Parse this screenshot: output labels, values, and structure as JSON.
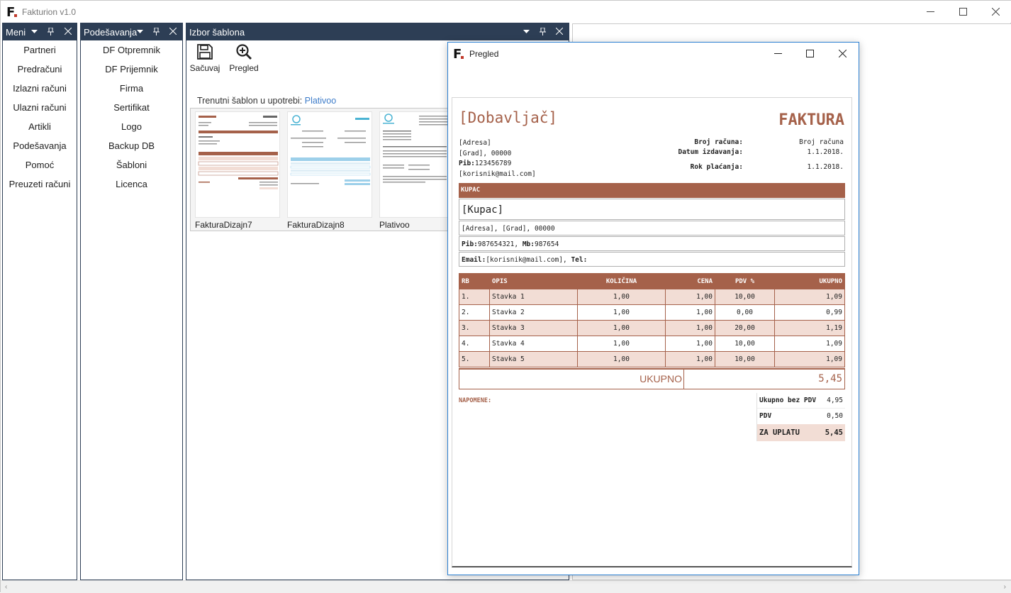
{
  "app": {
    "title": "Fakturion v1.0",
    "logo_letter": "F."
  },
  "menu_panel": {
    "title": "Meni",
    "items": [
      "Partneri",
      "Predračuni",
      "Izlazni računi",
      "Ulazni računi",
      "Artikli",
      "Podešavanja",
      "Pomoć",
      "Preuzeti računi"
    ]
  },
  "settings_panel": {
    "title": "Podešavanja",
    "items": [
      "DF Otpremnik",
      "DF Prijemnik",
      "Firma",
      "Sertifikat",
      "Logo",
      "Backup DB",
      "Šabloni",
      "Licenca"
    ]
  },
  "template_panel": {
    "title": "Izbor šablona",
    "save_label": "Sačuvaj",
    "preview_label": "Pregled",
    "current_label": "Trenutni šablon u upotrebi:",
    "current_value": "Plativoo",
    "templates": [
      "FakturaDizajn7",
      "FakturaDizajn8",
      "Plativoo"
    ]
  },
  "preview_window": {
    "title": "Pregled",
    "invoice": {
      "supplier": "[Dobavljač]",
      "doc_title": "FAKTURA",
      "address": "[Adresa]",
      "city": "[Grad], 00000",
      "pib_label": "Pib:",
      "pib": "123456789",
      "email": "[korisnik@mail.com]",
      "invoice_no_label": "Broj računa:",
      "invoice_no": "Broj računa",
      "issue_date_label": "Datum izdavanja:",
      "issue_date": "1.1.2018.",
      "due_label": "Rok plaćanja:",
      "due_date": "1.1.2018.",
      "buyer_section": "KUPAC",
      "buyer_name": "[Kupac]",
      "buyer_address": "[Adresa], [Grad], 00000",
      "buyer_pib_label": "Pib:",
      "buyer_pib": "987654321, ",
      "buyer_mb_label": "Mb:",
      "buyer_mb": "987654",
      "buyer_email_label": "Email:",
      "buyer_email": "[korisnik@mail.com], ",
      "buyer_tel_label": "Tel:",
      "columns": [
        "RB",
        "OPIS",
        "KOLIČINA",
        "CENA",
        "PDV %",
        "UKUPNO"
      ],
      "rows": [
        [
          "1.",
          "Stavka 1",
          "1,00",
          "1,00",
          "10,00",
          "1,09"
        ],
        [
          "2.",
          "Stavka 2",
          "1,00",
          "1,00",
          "0,00",
          "0,99"
        ],
        [
          "3.",
          "Stavka 3",
          "1,00",
          "1,00",
          "20,00",
          "1,19"
        ],
        [
          "4.",
          "Stavka 4",
          "1,00",
          "1,00",
          "10,00",
          "1,09"
        ],
        [
          "5.",
          "Stavka 5",
          "1,00",
          "1,00",
          "10,00",
          "1,09"
        ]
      ],
      "total_label": "UKUPNO",
      "total_value": "5,45",
      "notes_label": "NAPOMENE:",
      "sum_without_vat_label": "Ukupno bez PDV",
      "sum_without_vat": "4,95",
      "vat_label": "PDV",
      "vat": "0,50",
      "pay_label": "ZA UPLATU",
      "pay": "5,45"
    }
  },
  "colors": {
    "panel_header": "#2d3e55",
    "invoice_accent": "#a5614a",
    "row_alt": "#f2ddd5",
    "link": "#3d7cc9",
    "preview_border": "#2b7fd1"
  },
  "icons": [
    "save-icon",
    "zoom-in-icon",
    "pin-icon",
    "close-icon",
    "dropdown-arrow-icon",
    "minimize-icon",
    "maximize-icon"
  ]
}
